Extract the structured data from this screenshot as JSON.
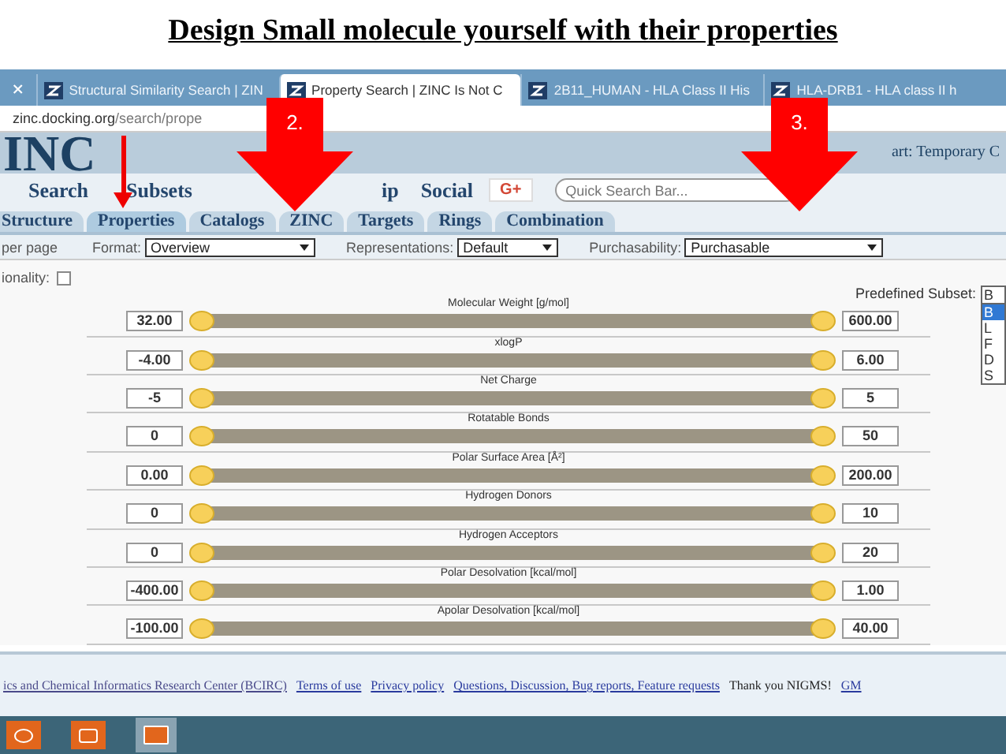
{
  "slide_title": "Design Small molecule yourself with their properties",
  "browser_tabs": [
    {
      "label": "Structural Similarity Search | ZIN",
      "selected": false
    },
    {
      "label": "Property Search | ZINC Is Not C",
      "selected": true
    },
    {
      "label": "2B11_HUMAN - HLA Class II His",
      "selected": false
    },
    {
      "label": "HLA-DRB1 - HLA class II h",
      "selected": false
    }
  ],
  "address": {
    "host": "zinc.docking.org",
    "path": "/search/prope"
  },
  "header": {
    "logo": "INC",
    "cart": "art: Temporary C"
  },
  "nav": [
    "Search",
    "Subsets",
    "ip",
    "Social"
  ],
  "gplus": "G+",
  "quick_search": {
    "placeholder": "Quick Search Bar..."
  },
  "tabs": [
    {
      "label": "Structure",
      "selected": false
    },
    {
      "label": "Properties",
      "selected": true
    },
    {
      "label": "Catalogs",
      "selected": false
    },
    {
      "label": "ZINC",
      "selected": false
    },
    {
      "label": "Targets",
      "selected": false
    },
    {
      "label": "Rings",
      "selected": false
    },
    {
      "label": "Combination",
      "selected": false
    }
  ],
  "options": {
    "per_page": "per page",
    "format_label": "Format:",
    "format": "Overview",
    "representations_label": "Representations:",
    "representations": "Default",
    "purchasability_label": "Purchasability:",
    "purchasability": "Purchasable"
  },
  "functionality": {
    "label": "ionality:",
    "checked": false
  },
  "predefined": {
    "label": "Predefined Subset:",
    "value": "B",
    "items": [
      {
        "label": "B",
        "selected": true
      },
      {
        "label": "L",
        "selected": false
      },
      {
        "label": "F",
        "selected": false
      },
      {
        "label": "D",
        "selected": false
      },
      {
        "label": "S",
        "selected": false
      }
    ]
  },
  "sliders": [
    {
      "name": "Molecular Weight [g/mol]",
      "min": "32.00",
      "max": "600.00",
      "level": 1
    },
    {
      "name": "xlogP",
      "min": "-4.00",
      "max": "6.00",
      "level": 1
    },
    {
      "name": "Net Charge",
      "min": "-5",
      "max": "5",
      "level": 1
    },
    {
      "name": "Rotatable Bonds",
      "min": "0",
      "max": "50",
      "level": 1
    },
    {
      "name": "Polar Surface Area [Å²]",
      "min": "0.00",
      "max": "200.00",
      "level": 1
    },
    {
      "name": "Hydrogen Donors",
      "min": "0",
      "max": "10",
      "level": 1
    },
    {
      "name": "Hydrogen Acceptors",
      "min": "0",
      "max": "20",
      "level": 1
    },
    {
      "name": "Polar Desolvation [kcal/mol]",
      "min": "-400.00",
      "max": "1.00",
      "level": 1
    },
    {
      "name": "Apolar Desolvation [kcal/mol]",
      "min": "-100.00",
      "max": "40.00",
      "level": 1
    }
  ],
  "footer": {
    "lead": "ics and Chemical Informatics Research Center (BCIRC)",
    "links": [
      "Terms of use",
      "Privacy policy",
      "Questions, Discussion, Bug reports, Feature requests"
    ],
    "thanks": "Thank you NIGMS!",
    "tail": "GM"
  },
  "annotations": [
    {
      "label": "2.",
      "kind": "big"
    },
    {
      "label": "3.",
      "kind": "big"
    },
    {
      "kind": "thin"
    }
  ]
}
